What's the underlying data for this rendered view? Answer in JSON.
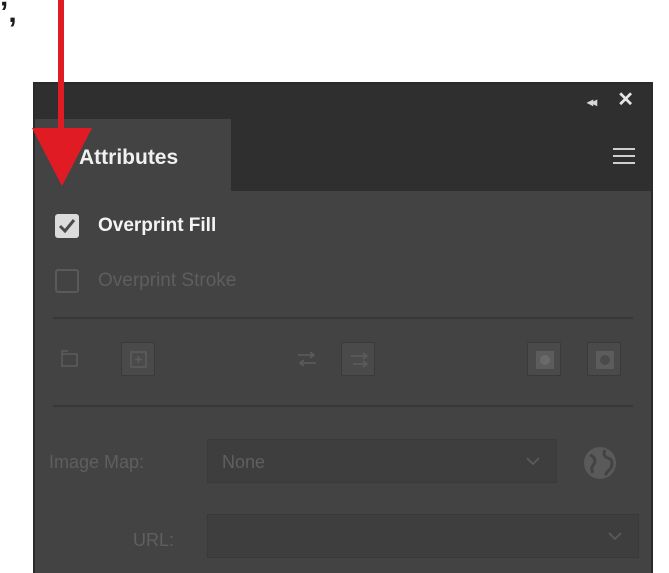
{
  "window": {
    "corner_glyph": "ʼ,"
  },
  "titlebar": {
    "collapse_glyph": "◂◂",
    "close_glyph": "✕"
  },
  "tab": {
    "label": "Attributes",
    "menu_icon": "hamburger-icon"
  },
  "options": {
    "overprint_fill": {
      "label": "Overprint Fill",
      "checked": true
    },
    "overprint_stroke": {
      "label": "Overprint Stroke",
      "checked": false
    }
  },
  "image_map": {
    "label": "Image Map:",
    "value": "None"
  },
  "url": {
    "label": "URL:",
    "value": ""
  },
  "colors": {
    "panel_bg": "#434343",
    "titlebar_bg": "#2f2f2f",
    "annotation_arrow": "#e01b24"
  }
}
